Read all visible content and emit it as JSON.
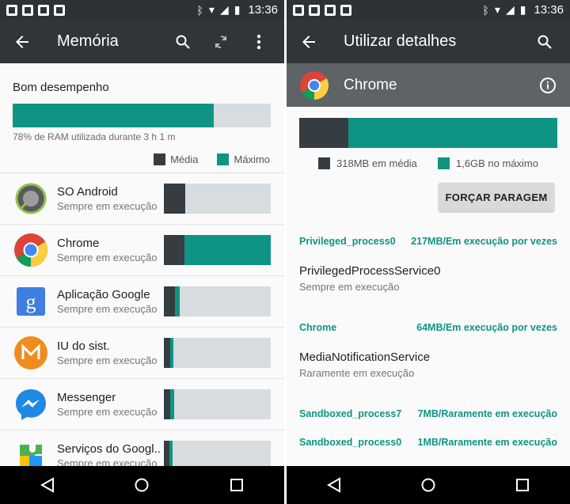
{
  "status_bar": {
    "time": "13:36"
  },
  "left_screen": {
    "title": "Memória",
    "summary": {
      "heading": "Bom desempenho",
      "ram_fraction": 0.78,
      "caption": "78% de RAM utilizada durante 3 h 1 m",
      "legend_avg": "Média",
      "legend_max": "Máximo"
    },
    "apps": [
      {
        "name": "SO Android",
        "status": "Sempre em execução",
        "icon": "android-os-icon",
        "avg": 0.2,
        "max": 0.2
      },
      {
        "name": "Chrome",
        "status": "Sempre em execução",
        "icon": "chrome-icon",
        "avg": 0.19,
        "max": 1.0
      },
      {
        "name": "Aplicação Google",
        "status": "Sempre em execução",
        "icon": "google-app-icon",
        "avg": 0.1,
        "max": 0.15
      },
      {
        "name": "IU do sist.",
        "status": "Sempre em execução",
        "icon": "system-ui-icon",
        "avg": 0.06,
        "max": 0.09
      },
      {
        "name": "Messenger",
        "status": "Sempre em execução",
        "icon": "messenger-icon",
        "avg": 0.06,
        "max": 0.1
      },
      {
        "name": "Serviços do Googl..",
        "status": "Sempre em execução",
        "icon": "play-services-icon",
        "avg": 0.05,
        "max": 0.08
      }
    ]
  },
  "right_screen": {
    "title": "Utilizar detalhes",
    "app_name": "Chrome",
    "avg_fraction": 0.19,
    "legend_avg": "318MB em média",
    "legend_max": "1,6GB no máximo",
    "force_stop_label": "FORÇAR PARAGEM",
    "processes": [
      {
        "name": "Privileged_process0",
        "info": "217MB/Em execução por vezes"
      },
      {
        "name": "Chrome",
        "info": "64MB/Em execução por vezes"
      },
      {
        "name": "Sandboxed_process7",
        "info": "7MB/Raramente em execução"
      },
      {
        "name": "Sandboxed_process0",
        "info": "1MB/Raramente em execução"
      }
    ],
    "services": [
      {
        "name": "PrivilegedProcessService0",
        "status": "Sempre em execução"
      },
      {
        "name": "MediaNotificationService",
        "status": "Raramente em execução"
      }
    ]
  },
  "colors": {
    "accent": "#0f9484",
    "average": "#363d42",
    "track": "#d6dcdf",
    "appbar": "#2f3538"
  }
}
